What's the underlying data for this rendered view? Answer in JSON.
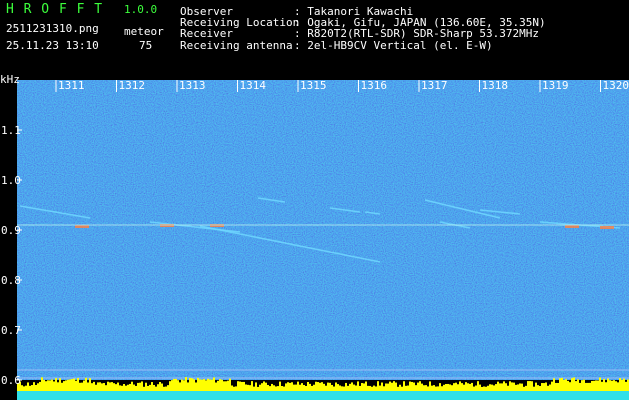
{
  "app": {
    "name": "H R O F F T",
    "version": "1.0.0"
  },
  "file": {
    "name": "2511231310.png",
    "datetime": "25.11.23 13:10"
  },
  "meteor": {
    "label": "meteor",
    "count": "75"
  },
  "station": {
    "observer_label": "Observer",
    "observer_value": ": Takanori Kawachi",
    "location_label": "Receiving Location",
    "location_value": ": Ogaki, Gifu, JAPAN (136.60E, 35.35N)",
    "receiver_label": "Receiver",
    "receiver_value": ": R820T2(RTL-SDR) SDR-Sharp 53.372MHz",
    "antenna_label": "Receiving antenna",
    "antenna_value": ": 2el-HB9CV Vertical (el. E-W)"
  },
  "spectrogram": {
    "unit_label": "kHz",
    "time_ticks": [
      "1311",
      "1312",
      "1313",
      "1314",
      "1315",
      "1316",
      "1317",
      "1318",
      "1319",
      "1320"
    ],
    "freq_ticks": [
      "1.1",
      "1.0",
      "0.9",
      "0.8",
      "0.7",
      "0.6"
    ],
    "freq_tick_values": [
      1.1,
      1.0,
      0.9,
      0.8,
      0.7,
      0.6
    ],
    "background_color": "#10208a",
    "carrier_freq_khz": 0.91,
    "baseline_color": "#30e0e8",
    "level_bar_color": "#ffff00"
  }
}
